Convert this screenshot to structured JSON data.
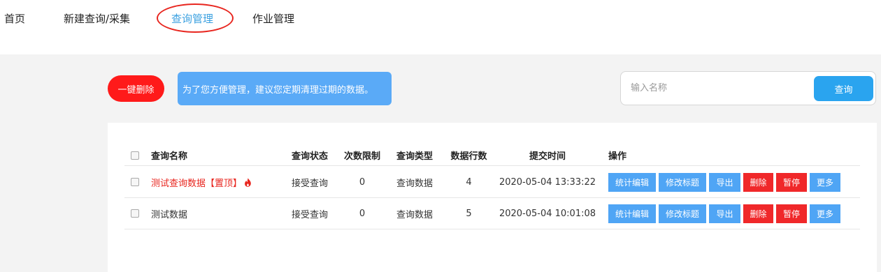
{
  "nav": {
    "home": "首页",
    "new_query": "新建查询/采集",
    "query_manage": "查询管理",
    "job_manage": "作业管理"
  },
  "toolbar": {
    "delete_all_label": "一键删除",
    "tip_text": "为了您方便管理，建议您定期清理过期的数据。",
    "search_placeholder": "输入名称",
    "search_value": "",
    "search_button": "查询"
  },
  "table": {
    "headers": {
      "name": "查询名称",
      "status": "查询状态",
      "limit": "次数限制",
      "type": "查询类型",
      "rows": "数据行数",
      "time": "提交时间",
      "ops": "操作"
    },
    "rows": [
      {
        "name": "测试查询数据",
        "pinned_tag": "【置顶】",
        "pinned": true,
        "status": "接受查询",
        "limit": "0",
        "type": "查询数据",
        "rows": "4",
        "time": "2020-05-04 13:33:22"
      },
      {
        "name": "测试数据",
        "pinned_tag": "",
        "pinned": false,
        "status": "接受查询",
        "limit": "0",
        "type": "查询数据",
        "rows": "5",
        "time": "2020-05-04 10:01:08"
      }
    ],
    "actions": {
      "stats_edit": "统计编辑",
      "edit_title": "修改标题",
      "export": "导出",
      "delete": "删除",
      "pause": "暂停",
      "more": "更多"
    }
  },
  "icons": {
    "pinned": "fire-icon"
  },
  "colors": {
    "accent_blue": "#2aa4ef",
    "button_blue": "#4fa5f5",
    "danger_red": "#f0282a",
    "pinned_text": "#e8261f",
    "tip_background": "#5aaaf7",
    "annotation_circle": "#e8261f"
  }
}
